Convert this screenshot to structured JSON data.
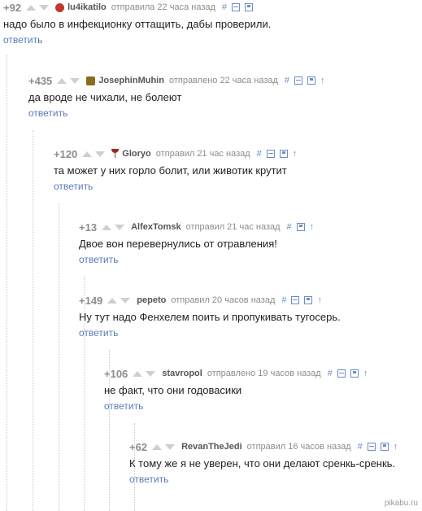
{
  "comments": [
    {
      "rating": "+92",
      "author": "lu4ikatilo",
      "time": "отправила 22 часа назад",
      "text": "надо было в инфекционку оттащить, дабы проверили.",
      "reply": "ответить"
    },
    {
      "rating": "+435",
      "author": "JosephinMuhin",
      "time": "отправлено 22 часа назад",
      "text": "да вроде не чихали, не болеют",
      "reply": "ответить"
    },
    {
      "rating": "+120",
      "author": "Gloryo",
      "time": "отправил 21 час назад",
      "text": "та может у них горло болит, или животик крутит",
      "reply": "ответить"
    },
    {
      "rating": "+13",
      "author": "AlfexTomsk",
      "time": "отправил 21 час назад",
      "text": "Двое вон перевернулись от отравления!",
      "reply": "ответить"
    },
    {
      "rating": "+149",
      "author": "pepeto",
      "time": "отправил 20 часов назад",
      "text": "Ну тут надо Фенхелем поить и пропукивать тугосерь.",
      "reply": "ответить"
    },
    {
      "rating": "+106",
      "author": "stavropol",
      "time": "отправлено 19 часов назад",
      "text": "не факт, что они годовасики",
      "reply": "ответить"
    },
    {
      "rating": "+62",
      "author": "RevanTheJedi",
      "time": "отправил 16 часов назад",
      "text": "К тому же я не уверен, что они делают сренкь-сренкь.",
      "reply": "ответить"
    }
  ],
  "icons": {
    "hash": "#",
    "up_arrow": "↑"
  },
  "watermark": "pikabu.ru",
  "colors": {
    "link": "#5b7ab8",
    "icon": "#6d8cc7",
    "muted": "#8c8c8c"
  }
}
